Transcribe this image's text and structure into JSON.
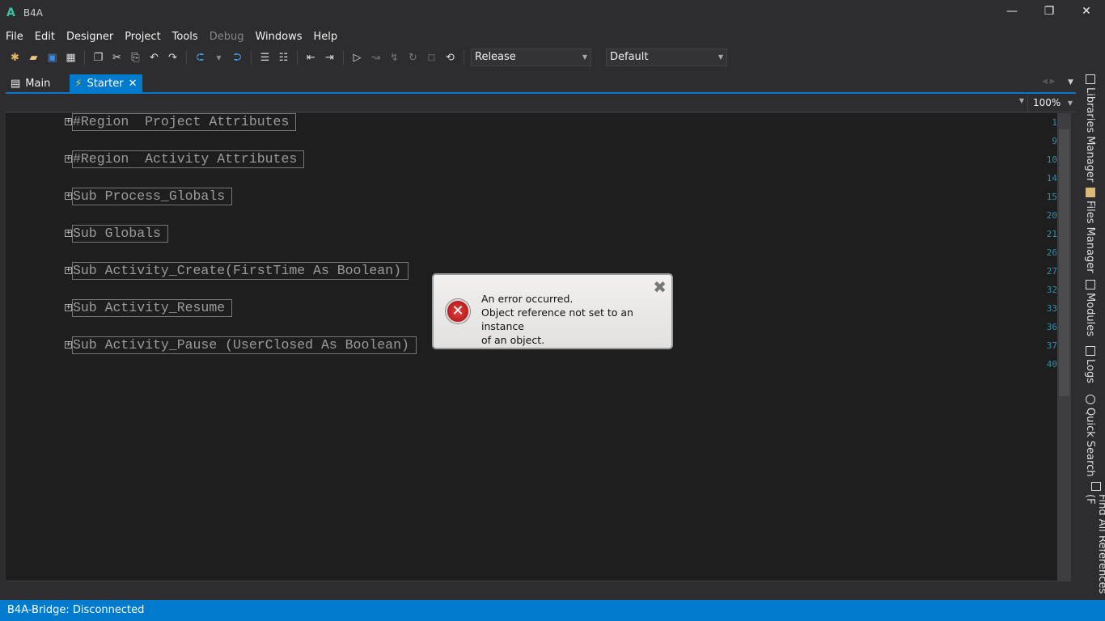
{
  "window": {
    "logo": "A",
    "title": "B4A",
    "minimize": "—",
    "restore": "❐",
    "close": "✕"
  },
  "menu": [
    "File",
    "Edit",
    "Designer",
    "Project",
    "Tools",
    "Debug",
    "Windows",
    "Help"
  ],
  "toolbar": {
    "build_config": "Release",
    "device": "Default"
  },
  "tabs": [
    {
      "label": "Main"
    },
    {
      "label": "Starter",
      "close": "✕"
    }
  ],
  "zoom": "100%",
  "code_lines": [
    {
      "num": "1",
      "text": "#Region  Project Attributes",
      "fold": "+"
    },
    {
      "num": "9"
    },
    {
      "num": "10",
      "text": "#Region  Activity Attributes",
      "fold": "+"
    },
    {
      "num": "14"
    },
    {
      "num": "15",
      "text": "Sub Process_Globals",
      "fold": "+"
    },
    {
      "num": "20"
    },
    {
      "num": "21",
      "text": "Sub Globals",
      "fold": "+"
    },
    {
      "num": "26"
    },
    {
      "num": "27",
      "text": "Sub Activity_Create(FirstTime As Boolean)",
      "fold": "+"
    },
    {
      "num": "32"
    },
    {
      "num": "33",
      "text": "Sub Activity_Resume",
      "fold": "+"
    },
    {
      "num": "36"
    },
    {
      "num": "37",
      "text": "Sub Activity_Pause (UserClosed As Boolean)",
      "fold": "+"
    },
    {
      "num": "40"
    }
  ],
  "sidebar": [
    "Libraries Manager",
    "Files Manager",
    "Modules",
    "Logs",
    "Quick Search",
    "Find All References (F"
  ],
  "dialog": {
    "line1": "An error occurred.",
    "line2": "Object reference not set to an instance",
    "line3": "of an object.",
    "close": "✖",
    "icon": "✕"
  },
  "status": "B4A-Bridge: Disconnected"
}
